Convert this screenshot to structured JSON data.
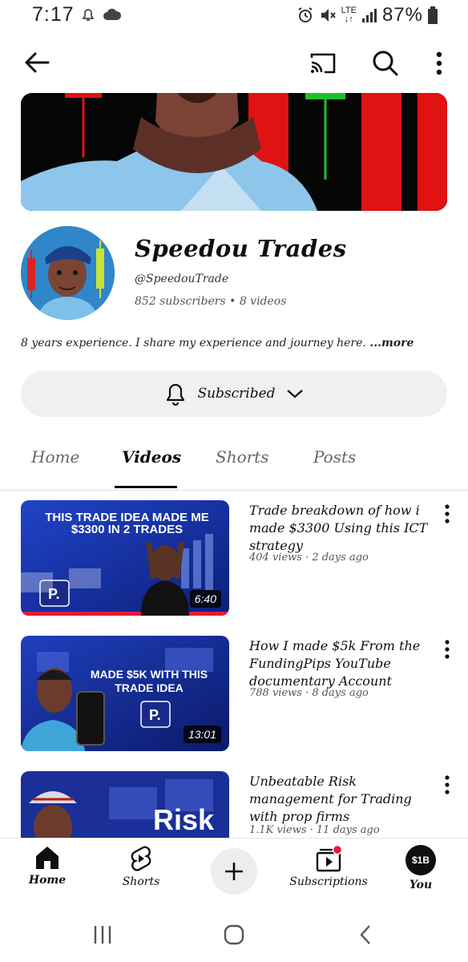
{
  "status_bar": {
    "time": "7:17",
    "network": "LTE",
    "battery": "87%"
  },
  "channel": {
    "name": "Speedou Trades",
    "handle": "@SpeedouTrade",
    "stats": "852 subscribers • 8 videos",
    "description": "8 years experience.  I share my experience and journey here.",
    "more_label": "...more",
    "subscribe_label": "Subscribed"
  },
  "tabs": [
    {
      "label": "Home",
      "active": false
    },
    {
      "label": "Videos",
      "active": true
    },
    {
      "label": "Shorts",
      "active": false
    },
    {
      "label": "Posts",
      "active": false
    }
  ],
  "videos": [
    {
      "title": "Trade breakdown of how i made $3300 Using this ICT strategy",
      "meta": "404 views · 2 days ago",
      "duration": "6:40",
      "thumb_text": "THIS TRADE IDEA MADE ME $3300 IN 2 TRADES"
    },
    {
      "title": "How I made $5k From the FundingPips YouTube documentary Account",
      "meta": "788 views · 8 days ago",
      "duration": "13:01",
      "thumb_text": "MADE $5K WITH THIS TRADE IDEA"
    },
    {
      "title": "Unbeatable Risk management for Trading with prop firms",
      "meta": "1.1K views · 11 days ago",
      "duration": "",
      "thumb_text": "Risk"
    }
  ],
  "bottom_nav": {
    "home": "Home",
    "shorts": "Shorts",
    "subscriptions": "Subscriptions",
    "you": "You",
    "you_avatar_text": "$1B"
  },
  "colors": {
    "brand_red": "#ff0000",
    "thumb_blue": "#1c3bb3",
    "chip_bg": "#f0f0f0"
  }
}
